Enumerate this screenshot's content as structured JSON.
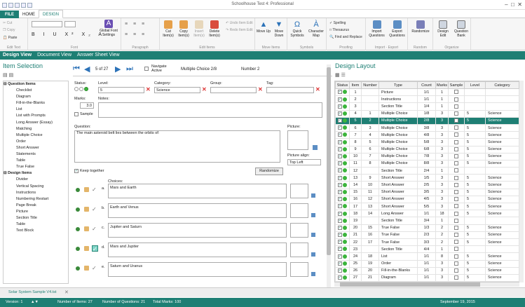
{
  "window": {
    "title": "Schoolhouse Test 4: Professional"
  },
  "tabs": {
    "file": "FILE",
    "home": "HOME",
    "design": "DESIGN"
  },
  "clipboard": {
    "cut": "Cut",
    "copy": "Copy",
    "paste": "Paste",
    "label": "Edit Text"
  },
  "font": {
    "label": "Font",
    "global": "Global Font Settings"
  },
  "paragraph": {
    "label": "Paragraph"
  },
  "items_group": {
    "cut": "Cut Item(s)",
    "copy": "Copy Item(s)",
    "insert": "Insert Item(s)",
    "delete": "Delete Item(s)",
    "undo": "Undo Item Edit",
    "redo": "Redo Item Edit",
    "label": "Edit Items"
  },
  "move": {
    "up": "Move Up",
    "down": "Move Down",
    "label": "Move Items"
  },
  "symbols": {
    "quick": "Quick Symbols",
    "map": "Character Map",
    "label": "Symbols"
  },
  "proofing": {
    "spelling": "Spelling",
    "thesaurus": "Thesaurus",
    "find": "Find and Replace",
    "label": "Proofing"
  },
  "impexp": {
    "import": "Import Questions",
    "export": "Export Questions",
    "label": "Import · Export"
  },
  "random": {
    "btn": "Randomize",
    "label": "Random"
  },
  "organize": {
    "grid": "Design Edit",
    "bank": "Question Bank",
    "label": "Organize"
  },
  "modes": {
    "design": "Design View",
    "document": "Document View",
    "answer": "Answer Sheet View"
  },
  "item_selection": {
    "title": "Item Selection"
  },
  "tree": [
    {
      "label": "Question Items",
      "hdr": true
    },
    {
      "label": "Checklist"
    },
    {
      "label": "Diagram"
    },
    {
      "label": "Fill-in-the-Blanks"
    },
    {
      "label": "List"
    },
    {
      "label": "List with Prompts"
    },
    {
      "label": "Long Answer (Essay)"
    },
    {
      "label": "Matching"
    },
    {
      "label": "Multiple Choice"
    },
    {
      "label": "Order"
    },
    {
      "label": "Short Answer"
    },
    {
      "label": "Statements"
    },
    {
      "label": "Table"
    },
    {
      "label": "True False"
    },
    {
      "label": "Design Items",
      "hdr": true
    },
    {
      "label": "Divider"
    },
    {
      "label": "Vertical Spacing"
    },
    {
      "label": "Instructions"
    },
    {
      "label": "Numbering Restart"
    },
    {
      "label": "Page Break"
    },
    {
      "label": "Picture"
    },
    {
      "label": "Section Title"
    },
    {
      "label": "Table"
    },
    {
      "label": "Text Block"
    }
  ],
  "nav": {
    "position": "5 of 27",
    "navigate_active": "Navigate Active",
    "type": "Multiple Choice 2/8",
    "number": "Number 2"
  },
  "editor": {
    "status_label": "Status:",
    "level_label": "Level:",
    "level_value": "5",
    "category_label": "Category:",
    "category_value": "Science",
    "group_label": "Group:",
    "group_value": "",
    "tag_label": "Tag:",
    "tag_value": "",
    "marks_label": "Marks:",
    "marks_value": "3.0",
    "sample_label": "Sample",
    "notes_label": "Notes:",
    "question_label": "Question:",
    "question_text": "The main asteroid belt lies between the orbits of:",
    "picture_label": "Picture:",
    "picture_align_label": "Picture align:",
    "picture_align_value": "Top Left",
    "keep_together": "Keep together",
    "randomize": "Randomize",
    "choices_label": "Choices:"
  },
  "choices": [
    {
      "letter": "a.",
      "text": "Mars and Earth",
      "correct": false
    },
    {
      "letter": "b.",
      "text": "Earth and Venus",
      "correct": false
    },
    {
      "letter": "c.",
      "text": "Jupiter and Saturn",
      "correct": false
    },
    {
      "letter": "d.",
      "text": "Mars and Jupiter",
      "correct": true
    },
    {
      "letter": "e.",
      "text": "Saturn and Uranus",
      "correct": false
    }
  ],
  "design_layout": {
    "title": "Design Layout",
    "headers": [
      "Status",
      "Item",
      "Number",
      "Type",
      "Count",
      "Marks",
      "Sample",
      "Level",
      "Category"
    ],
    "rows": [
      {
        "item": "1",
        "number": "",
        "type": "Picture",
        "count": "1/1",
        "marks": "1",
        "sample": "",
        "level": "",
        "category": ""
      },
      {
        "item": "2",
        "number": "",
        "type": "Instructions",
        "count": "1/1",
        "marks": "1",
        "sample": "",
        "level": "",
        "category": ""
      },
      {
        "item": "3",
        "number": "",
        "type": "Section Title",
        "count": "1/4",
        "marks": "1",
        "sample": "",
        "level": "",
        "category": ""
      },
      {
        "item": "4",
        "number": "1",
        "type": "Multiple Choice",
        "count": "1/8",
        "marks": "3",
        "sample": "",
        "level": "5",
        "category": "Science"
      },
      {
        "item": "5",
        "number": "2",
        "type": "Multiple Choice",
        "count": "2/8",
        "marks": "3",
        "sample": "",
        "level": "5",
        "category": "Science",
        "sel": true
      },
      {
        "item": "6",
        "number": "3",
        "type": "Multiple Choice",
        "count": "3/8",
        "marks": "3",
        "sample": "",
        "level": "5",
        "category": "Science"
      },
      {
        "item": "7",
        "number": "4",
        "type": "Multiple Choice",
        "count": "4/8",
        "marks": "3",
        "sample": "",
        "level": "5",
        "category": "Science"
      },
      {
        "item": "8",
        "number": "5",
        "type": "Multiple Choice",
        "count": "5/8",
        "marks": "3",
        "sample": "",
        "level": "5",
        "category": "Science"
      },
      {
        "item": "9",
        "number": "6",
        "type": "Multiple Choice",
        "count": "6/8",
        "marks": "3",
        "sample": "",
        "level": "5",
        "category": "Science"
      },
      {
        "item": "10",
        "number": "7",
        "type": "Multiple Choice",
        "count": "7/8",
        "marks": "3",
        "sample": "",
        "level": "5",
        "category": "Science"
      },
      {
        "item": "11",
        "number": "8",
        "type": "Multiple Choice",
        "count": "8/8",
        "marks": "3",
        "sample": "",
        "level": "5",
        "category": "Science"
      },
      {
        "item": "12",
        "number": "",
        "type": "Section Title",
        "count": "2/4",
        "marks": "1",
        "sample": "",
        "level": "",
        "category": ""
      },
      {
        "item": "13",
        "number": "9",
        "type": "Short Answer",
        "count": "1/5",
        "marks": "3",
        "sample": "",
        "level": "5",
        "category": "Science"
      },
      {
        "item": "14",
        "number": "10",
        "type": "Short Answer",
        "count": "2/5",
        "marks": "3",
        "sample": "",
        "level": "5",
        "category": "Science"
      },
      {
        "item": "15",
        "number": "11",
        "type": "Short Answer",
        "count": "3/5",
        "marks": "3",
        "sample": "",
        "level": "5",
        "category": "Science"
      },
      {
        "item": "16",
        "number": "12",
        "type": "Short Answer",
        "count": "4/5",
        "marks": "3",
        "sample": "",
        "level": "5",
        "category": "Science"
      },
      {
        "item": "17",
        "number": "13",
        "type": "Short Answer",
        "count": "5/5",
        "marks": "3",
        "sample": "",
        "level": "5",
        "category": "Science"
      },
      {
        "item": "18",
        "number": "14",
        "type": "Long Answer",
        "count": "1/1",
        "marks": "18",
        "sample": "",
        "level": "5",
        "category": "Science"
      },
      {
        "item": "19",
        "number": "",
        "type": "Section Title",
        "count": "3/4",
        "marks": "1",
        "sample": "",
        "level": "",
        "category": ""
      },
      {
        "item": "20",
        "number": "15",
        "type": "True False",
        "count": "1/3",
        "marks": "2",
        "sample": "",
        "level": "5",
        "category": "Science"
      },
      {
        "item": "21",
        "number": "16",
        "type": "True False",
        "count": "2/3",
        "marks": "2",
        "sample": "",
        "level": "5",
        "category": "Science"
      },
      {
        "item": "22",
        "number": "17",
        "type": "True False",
        "count": "3/3",
        "marks": "2",
        "sample": "",
        "level": "5",
        "category": "Science"
      },
      {
        "item": "23",
        "number": "",
        "type": "Section Title",
        "count": "4/4",
        "marks": "1",
        "sample": "",
        "level": "",
        "category": ""
      },
      {
        "item": "24",
        "number": "18",
        "type": "List",
        "count": "1/1",
        "marks": "8",
        "sample": "",
        "level": "5",
        "category": "Science"
      },
      {
        "item": "25",
        "number": "19",
        "type": "Order",
        "count": "1/1",
        "marks": "3",
        "sample": "",
        "level": "5",
        "category": "Science"
      },
      {
        "item": "26",
        "number": "20",
        "type": "Fill-in-the-Blanks",
        "count": "1/1",
        "marks": "3",
        "sample": "",
        "level": "5",
        "category": "Science"
      },
      {
        "item": "27",
        "number": "21",
        "type": "Diagram",
        "count": "1/1",
        "marks": "3",
        "sample": "",
        "level": "5",
        "category": "Science"
      }
    ]
  },
  "doc_tab": "Solar System Sample V4.tst",
  "statusbar": {
    "version": "Version: 1",
    "items": "Number of Items: 27",
    "questions": "Number of Questions: 21",
    "marks": "Total Marks: 100",
    "date": "September 19, 2015"
  }
}
